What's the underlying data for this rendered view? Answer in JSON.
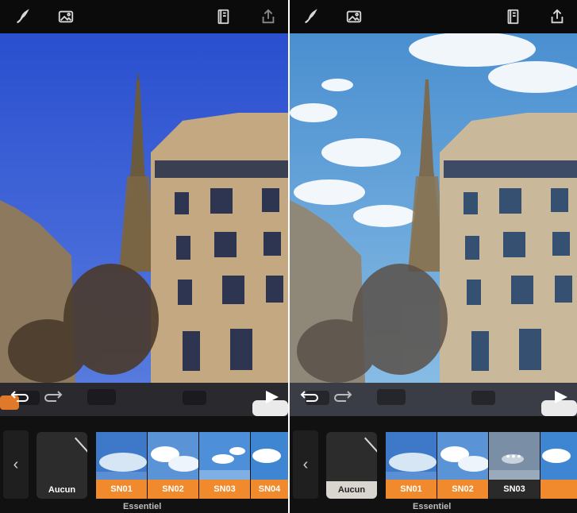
{
  "left_panel": {
    "toolbar": {
      "icons": [
        "brush-icon",
        "image-icon",
        "book-icon",
        "share-icon"
      ]
    },
    "filters": {
      "back_label": "‹",
      "none_label": "Aucun",
      "items": [
        "SN01",
        "SN02",
        "SN03",
        "SN04"
      ],
      "group_label": "Essentiel"
    }
  },
  "right_panel": {
    "toolbar": {
      "icons": [
        "brush-icon",
        "image-icon",
        "book-icon",
        "share-icon"
      ]
    },
    "filters": {
      "back_label": "‹",
      "none_label": "Aucun",
      "items": [
        "SN01",
        "SN02",
        "SN03"
      ],
      "active_item": "SN03",
      "loading_indicator": "•••",
      "group_label": "Essentiel"
    }
  },
  "colors": {
    "accent_orange": "#f08a2c",
    "sky_original": "#2f5fd0",
    "sky_edited": "#5fa3d8",
    "building": "#c8ad84"
  }
}
